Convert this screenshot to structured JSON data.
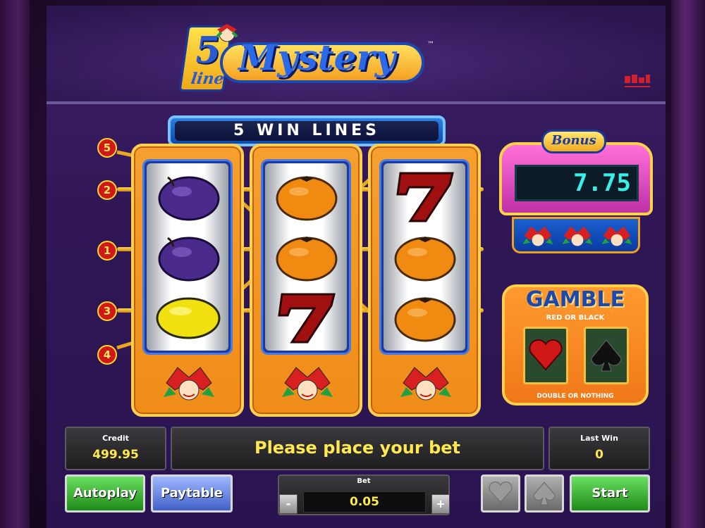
{
  "header": {
    "logo_digit": "5",
    "logo_line": "line",
    "logo_word": "Mystery",
    "trademark": "™"
  },
  "reels": {
    "win_lines_label": "5 WIN LINES",
    "line_numbers": [
      "5",
      "2",
      "1",
      "3",
      "4"
    ],
    "columns": [
      [
        "plum",
        "plum",
        "lemon"
      ],
      [
        "orange",
        "orange",
        "seven"
      ],
      [
        "seven",
        "orange",
        "orange"
      ]
    ]
  },
  "bonus": {
    "title": "Bonus",
    "value": "7.75"
  },
  "gamble": {
    "title": "GAMBLE",
    "subtitle": "RED OR BLACK",
    "footer": "DOUBLE OR NOTHING"
  },
  "status": {
    "credit_label": "Credit",
    "credit_value": "499.95",
    "message": "Please place your bet",
    "last_win_label": "Last Win",
    "last_win_value": "0"
  },
  "controls": {
    "autoplay_label": "Autoplay",
    "paytable_label": "Paytable",
    "bet_label": "Bet",
    "bet_value": "0.05",
    "bet_minus": "-",
    "bet_plus": "+",
    "start_label": "Start"
  },
  "colors": {
    "accent_gold": "#ffe850",
    "bonus_digits": "#38f0e8",
    "start_green": "#1e8a18",
    "paytable_blue": "#4060c8"
  }
}
